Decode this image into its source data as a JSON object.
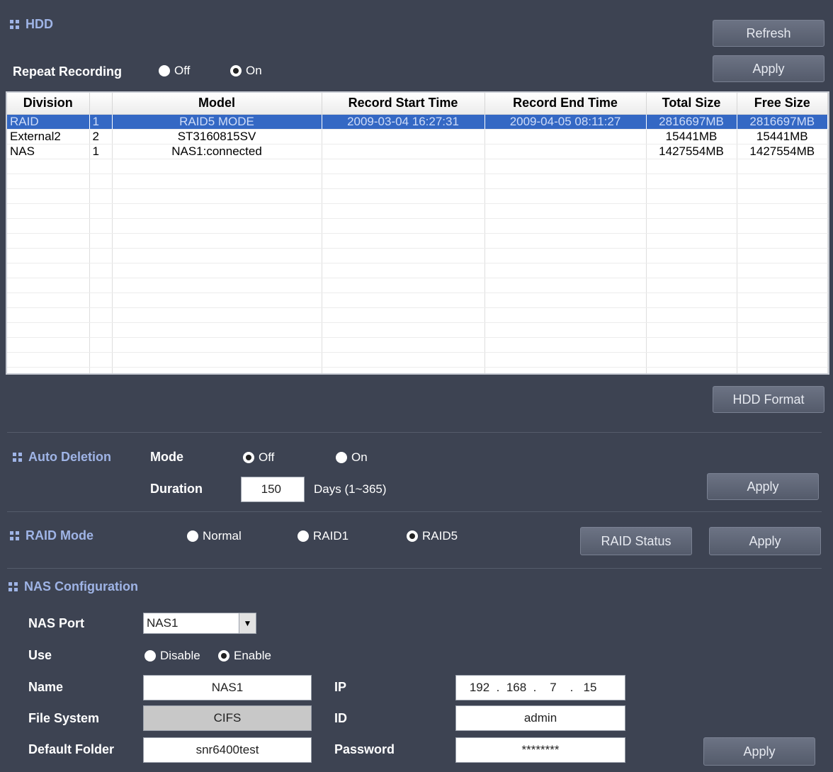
{
  "hdd": {
    "title": "HDD",
    "refresh_label": "Refresh",
    "apply_label": "Apply",
    "repeat_recording": {
      "label": "Repeat Recording",
      "off": "Off",
      "on": "On",
      "selected": "on"
    },
    "columns": [
      "Division",
      "",
      "Model",
      "Record Start Time",
      "Record End Time",
      "Total Size",
      "Free Size"
    ],
    "rows": [
      {
        "division": "RAID",
        "num": "1",
        "model": "RAID5 MODE",
        "start": "2009-03-04 16:27:31",
        "end": "2009-04-05 08:11:27",
        "total": "2816697MB",
        "free": "2816697MB",
        "selected": true
      },
      {
        "division": "External2",
        "num": "2",
        "model": "ST3160815SV",
        "start": "",
        "end": "",
        "total": "15441MB",
        "free": "15441MB",
        "selected": false
      },
      {
        "division": "NAS",
        "num": "1",
        "model": "NAS1:connected",
        "start": "",
        "end": "",
        "total": "1427554MB",
        "free": "1427554MB",
        "selected": false
      }
    ],
    "format_label": "HDD Format"
  },
  "auto_deletion": {
    "title": "Auto Deletion",
    "mode_label": "Mode",
    "off": "Off",
    "on": "On",
    "selected": "off",
    "duration_label": "Duration",
    "duration_value": "150",
    "duration_hint": "Days (1~365)",
    "apply_label": "Apply"
  },
  "raid_mode": {
    "title": "RAID Mode",
    "normal": "Normal",
    "raid1": "RAID1",
    "raid5": "RAID5",
    "selected": "raid5",
    "status_label": "RAID Status",
    "apply_label": "Apply"
  },
  "nas": {
    "title": "NAS Configuration",
    "port_label": "NAS Port",
    "port_value": "NAS1",
    "use_label": "Use",
    "disable": "Disable",
    "enable": "Enable",
    "use_selected": "enable",
    "name_label": "Name",
    "name_value": "NAS1",
    "fs_label": "File System",
    "fs_value": "CIFS",
    "folder_label": "Default Folder",
    "folder_value": "snr6400test",
    "ip_label": "IP",
    "ip": [
      "192",
      "168",
      "7",
      "15"
    ],
    "id_label": "ID",
    "id_value": "admin",
    "password_label": "Password",
    "password_value": "********",
    "apply_label": "Apply"
  }
}
